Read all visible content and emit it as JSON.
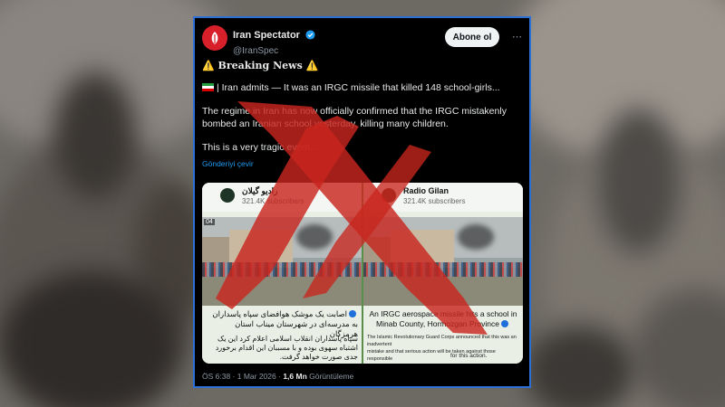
{
  "account": {
    "display_name": "Iran Spectator",
    "handle": "@IranSpec",
    "follow_label": "Abone ol",
    "more_label": "⋯"
  },
  "tweet": {
    "breaking": "⚠️ Breaking News ⚠️",
    "headline": "| Iran admits — It was an IRGC missile that killed 148 school-girls...",
    "paragraph": "The regime in Iran has now officially confirmed that the IRGC mistakenly bombed an Iranian school yesterday, killing many children.",
    "tragic": "This is a very tragic event...",
    "translate_label": "Gönderiyi çevir"
  },
  "media": {
    "left": {
      "channel_name": "راديو گيلان",
      "subscribers": "321.4K subscribers",
      "badge": "04",
      "caption1": "اصابت یک موشک هوافضای سپاه پاسداران به مدرسه‌ای در شهرستان میناب استان هرمزگان",
      "caption2": "سپاه پاسداران انقلاب اسلامی اعلام کرد این یک اشتباه سهوی بوده و با مسببان این اقدام برخورد جدی صورت خواهد گرفت."
    },
    "right": {
      "channel_name": "Radio Gilan",
      "subscribers": "321.4K subscribers",
      "caption1": "An IRGC aerospace missile hits a school in Minab County, Hormozgan Province",
      "caption2a": "The Islamic Revolutionary Guard Corps announced that this was an inadvertent",
      "caption2b": "mistake and that serious action will be taken against those responsible",
      "caption3": "for this action."
    }
  },
  "footer": {
    "time": "ÖS 6:38 · 1 Mar 2026 ·",
    "views_count": "1,6 Mn",
    "views_label": "Görüntüleme"
  },
  "colors": {
    "card_border": "#2c6fd6",
    "x_mark": "#c8261e",
    "link": "#1d9bf0",
    "verified": "#1d9bf0"
  },
  "icons": {
    "verified": "verified-badge-icon",
    "warning": "warning-icon",
    "flag": "iran-flag-icon",
    "cross": "red-x-icon"
  }
}
